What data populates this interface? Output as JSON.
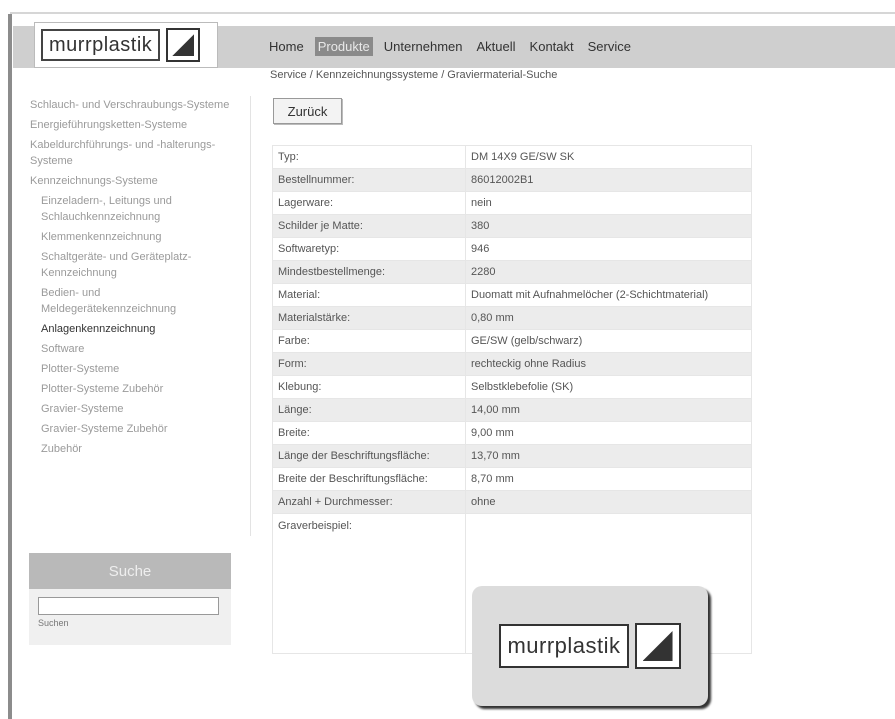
{
  "header": {
    "logo_text": "murrplastik",
    "nav": [
      {
        "label": "Home",
        "active": false
      },
      {
        "label": "Produkte",
        "active": true
      },
      {
        "label": "Unternehmen",
        "active": false
      },
      {
        "label": "Aktuell",
        "active": false
      },
      {
        "label": "Kontakt",
        "active": false
      },
      {
        "label": "Service",
        "active": false
      }
    ]
  },
  "breadcrumb": "Service / Kennzeichnungssysteme / Graviermaterial-Suche",
  "back_button": "Zurück",
  "sidebar": {
    "items": [
      {
        "label": "Schlauch- und Verschraubungs-Systeme",
        "level": 0,
        "current": false
      },
      {
        "label": "Energieführungsketten-Systeme",
        "level": 0,
        "current": false
      },
      {
        "label": "Kabeldurchführungs- und -halterungs-Systeme",
        "level": 0,
        "current": false
      },
      {
        "label": "Kennzeichnungs-Systeme",
        "level": 0,
        "current": false
      },
      {
        "label": "Einzeladern-, Leitungs und Schlauchkennzeichnung",
        "level": 1,
        "current": false
      },
      {
        "label": "Klemmenkennzeichnung",
        "level": 1,
        "current": false
      },
      {
        "label": "Schaltgeräte- und Geräteplatz-Kennzeichnung",
        "level": 1,
        "current": false
      },
      {
        "label": "Bedien- und Meldegerätekennzeichnung",
        "level": 1,
        "current": false
      },
      {
        "label": "Anlagenkennzeichnung",
        "level": 1,
        "current": true
      },
      {
        "label": "Software",
        "level": 1,
        "current": false
      },
      {
        "label": "Plotter-Systeme",
        "level": 1,
        "current": false
      },
      {
        "label": "Plotter-Systeme Zubehör",
        "level": 1,
        "current": false
      },
      {
        "label": "Gravier-Systeme",
        "level": 1,
        "current": false
      },
      {
        "label": "Gravier-Systeme Zubehör",
        "level": 1,
        "current": false
      },
      {
        "label": "Zubehör",
        "level": 1,
        "current": false
      }
    ]
  },
  "search": {
    "title": "Suche",
    "value": "",
    "button_label": "Suchen"
  },
  "spec_table": {
    "rows": [
      {
        "label": "Typ:",
        "value": "DM 14X9 GE/SW SK"
      },
      {
        "label": "Bestellnummer:",
        "value": "86012002B1"
      },
      {
        "label": "Lagerware:",
        "value": "nein"
      },
      {
        "label": "Schilder je Matte:",
        "value": "380"
      },
      {
        "label": "Softwaretyp:",
        "value": "946"
      },
      {
        "label": "Mindestbestellmenge:",
        "value": "2280"
      },
      {
        "label": "Material:",
        "value": "Duomatt mit Aufnahmelöcher (2-Schichtmaterial)"
      },
      {
        "label": "Materialstärke:",
        "value": "0,80 mm"
      },
      {
        "label": "Farbe:",
        "value": "GE/SW (gelb/schwarz)"
      },
      {
        "label": "Form:",
        "value": "rechteckig ohne Radius"
      },
      {
        "label": "Klebung:",
        "value": "Selbstklebefolie (SK)"
      },
      {
        "label": "Länge:",
        "value": "14,00 mm"
      },
      {
        "label": "Breite:",
        "value": "9,00 mm"
      },
      {
        "label": "Länge der Beschriftungsfläche:",
        "value": "13,70 mm"
      },
      {
        "label": "Breite der Beschriftungsfläche:",
        "value": "8,70 mm"
      },
      {
        "label": "Anzahl + Durchmesser:",
        "value": "ohne"
      }
    ],
    "engraving_label": "Graverbeispiel:",
    "engraving_text": "murrplastik"
  }
}
